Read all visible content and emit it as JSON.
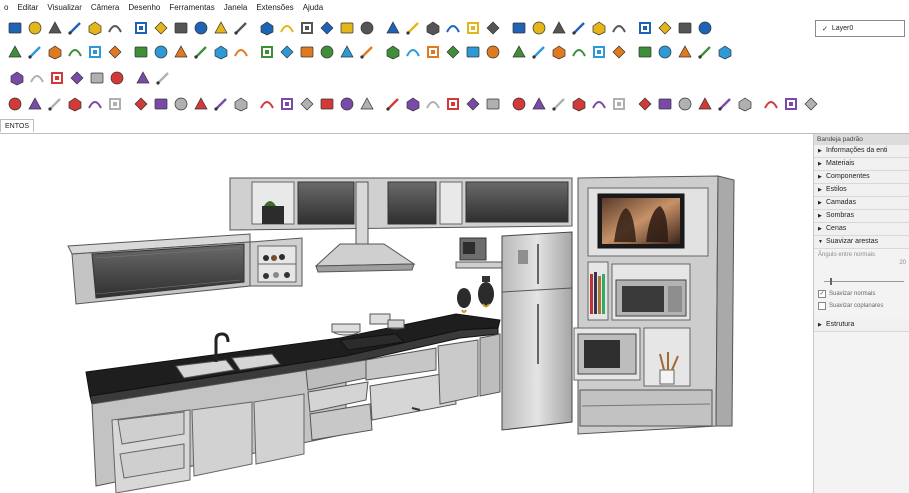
{
  "menu": [
    "o",
    "Editar",
    "Visualizar",
    "Câmera",
    "Desenho",
    "Ferramentas",
    "Janela",
    "Extensões",
    "Ajuda"
  ],
  "layer": {
    "check": "✓",
    "name": "Layer0"
  },
  "tab": {
    "label": "ENTOS"
  },
  "tray": {
    "title": "Bandeja padrão",
    "items": [
      {
        "label": "Informações da enti",
        "arrow": "▶"
      },
      {
        "label": "Materiais",
        "arrow": "▶"
      },
      {
        "label": "Componentes",
        "arrow": "▶"
      },
      {
        "label": "Estilos",
        "arrow": "▶"
      },
      {
        "label": "Camadas",
        "arrow": "▶"
      },
      {
        "label": "Sombras",
        "arrow": "▶"
      },
      {
        "label": "Cenas",
        "arrow": "▶"
      },
      {
        "label": "Suavizar arestas",
        "arrow": "▼"
      }
    ],
    "edge_panel": {
      "angle_label": "Ângulo entre normais",
      "angle_value": "20",
      "smooth_normals": "Suavizar normais",
      "smooth_coplanar": "Suavizar coplanares"
    },
    "structure": {
      "label": "Estrutura",
      "arrow": "▶"
    }
  },
  "colors": {
    "accent": "#1f63b6",
    "red": "#d23a3a",
    "green": "#3f8f3a",
    "yellow": "#e3b619",
    "cabinet": "#bdbdbd",
    "countertop": "#1e1e1e"
  },
  "toolbar_icons": {
    "row1": [
      "open-icon",
      "save-icon",
      "cut-icon",
      "copy-icon",
      "paste-icon",
      "erase-icon",
      "undo-icon",
      "redo-icon",
      "print-icon",
      "model-info-icon",
      "iso-view-icon",
      "top-view-icon",
      "front-view-icon",
      "right-view-icon",
      "back-view-icon",
      "left-view-icon",
      "xray-icon",
      "wireframe-icon",
      "hidden-line-icon",
      "shaded-icon",
      "textured-icon",
      "monochrome-icon",
      "house-icon",
      "house-top-icon",
      "house-front-icon",
      "house-back-icon",
      "section-icon",
      "section-fill-icon",
      "section-cut-icon",
      "warehouse-icon",
      "share-icon",
      "get-models-icon",
      "ext-warehouse-icon",
      "send-layout-icon",
      "layout-icon"
    ],
    "row2": [
      "orbit-icon",
      "paint-icon",
      "eraser-icon",
      "pencil-icon",
      "freehand-icon",
      "rectangle-icon",
      "rotated-rect-icon",
      "circle-icon",
      "polygon-icon",
      "arc-icon",
      "pie-icon",
      "two-point-arc-icon",
      "move-icon",
      "push-pull-icon",
      "rotate-icon",
      "follow-me-icon",
      "scale-icon",
      "offset-icon",
      "tape-icon",
      "dimension-icon",
      "protractor-icon",
      "text-icon",
      "axes-icon",
      "3d-text-icon",
      "orbit2-icon",
      "pan-icon",
      "zoom-icon",
      "zoom-window-icon",
      "zoom-extents-icon",
      "position-camera-icon",
      "look-around-icon",
      "walk-icon",
      "section-plane-icon",
      "sandbox-icon",
      "terrain-icon"
    ],
    "row3": [
      "solid-union-icon",
      "solid-subtract-icon",
      "solid-trim-icon",
      "solid-split-icon",
      "outer-shell-icon",
      "intersect-icon",
      "flip-icon",
      "rotate-comp-icon"
    ],
    "row4": [
      "path-icon",
      "joint-push-icon",
      "round-corner-icon",
      "fredo-scale-icon",
      "curviloft-icon",
      "bezier-icon",
      "profile-icon",
      "shape-bender-icon",
      "tools-on-surface-icon",
      "weld-icon",
      "extrude-edges-icon",
      "extrude-lines-icon",
      "lathe-icon",
      "tube-icon",
      "stairs-icon",
      "rail-icon",
      "window-tool-icon",
      "door-tool-icon",
      "roof-icon",
      "wall-icon",
      "building-icon",
      "cabinet-tool-icon",
      "drawer-tool-icon",
      "shelf-tool-icon",
      "grid-tool-icon",
      "arrow-tool-icon",
      "chair-icon",
      "table-icon",
      "sofa-icon",
      "bed-icon",
      "lamp-icon",
      "plant-icon",
      "rug-icon",
      "vase-icon",
      "helix-icon",
      "array-icon",
      "component-icon",
      "material-icon",
      "eye-icon"
    ]
  }
}
